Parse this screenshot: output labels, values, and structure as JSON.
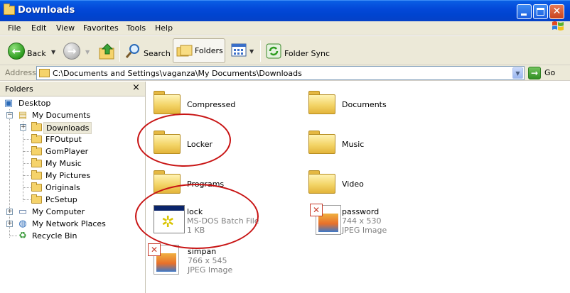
{
  "window": {
    "title": "Downloads"
  },
  "menu": [
    "File",
    "Edit",
    "View",
    "Favorites",
    "Tools",
    "Help"
  ],
  "toolbar": {
    "back_label": "Back",
    "search_label": "Search",
    "folders_label": "Folders",
    "foldersync_label": "Folder Sync"
  },
  "address": {
    "label": "Address",
    "path": "C:\\Documents and Settings\\vaganza\\My Documents\\Downloads",
    "go_label": "Go"
  },
  "folders_pane": {
    "title": "Folders",
    "close": "×",
    "tree": {
      "desktop": "Desktop",
      "my_documents": "My Documents",
      "downloads": "Downloads",
      "ffoutput": "FFOutput",
      "gomplayer": "GomPlayer",
      "my_music": "My Music",
      "my_pictures": "My Pictures",
      "originals": "Originals",
      "pcsetup": "PcSetup",
      "my_computer": "My Computer",
      "my_network_places": "My Network Places",
      "recycle_bin": "Recycle Bin"
    }
  },
  "items": {
    "compressed": {
      "name": "Compressed"
    },
    "documents": {
      "name": "Documents"
    },
    "locker": {
      "name": "Locker"
    },
    "music": {
      "name": "Music"
    },
    "programs": {
      "name": "Programs"
    },
    "video": {
      "name": "Video"
    },
    "lock": {
      "name": "lock",
      "type": "MS-DOS Batch File",
      "size": "1 KB"
    },
    "password": {
      "name": "password",
      "dims": "744 x 530",
      "type": "JPEG Image"
    },
    "simpan": {
      "name": "simpan",
      "dims": "766 x 545",
      "type": "JPEG Image"
    }
  },
  "colors": {
    "titlebar": "#0348d8",
    "annotation_circle": "#c81414",
    "chrome": "#ece9d8"
  }
}
